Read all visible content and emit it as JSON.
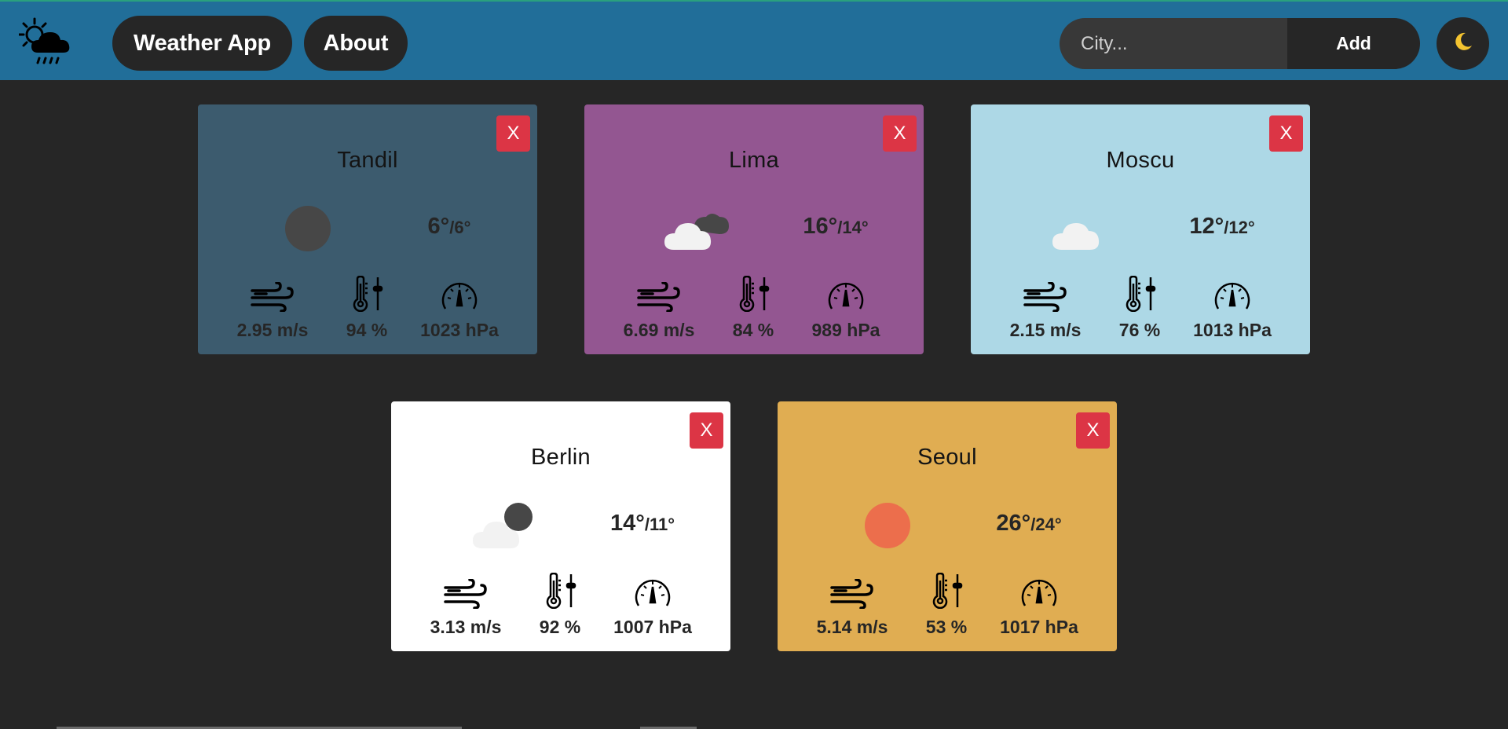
{
  "header": {
    "logo_icon": "sun-cloud-rain-icon",
    "nav": [
      {
        "label": "Weather App"
      },
      {
        "label": "About"
      }
    ],
    "search": {
      "placeholder": "City...",
      "value": "",
      "button_label": "Add"
    },
    "theme_toggle_icon": "moon-icon",
    "color": "#216e99"
  },
  "cards": [
    {
      "city": "Tandil",
      "temp_max": "6°",
      "temp_min": "/6°",
      "wind": "2.95 m/s",
      "humidity": "94 %",
      "pressure": "1023 hPa",
      "icon": "moon-icon",
      "bg": "#3c5b6e",
      "close_label": "X"
    },
    {
      "city": "Lima",
      "temp_max": "16°",
      "temp_min": "/14°",
      "wind": "6.69 m/s",
      "humidity": "84 %",
      "pressure": "989 hPa",
      "icon": "cloudy-night-icon",
      "bg": "#935691",
      "close_label": "X"
    },
    {
      "city": "Moscu",
      "temp_max": "12°",
      "temp_min": "/12°",
      "wind": "2.15 m/s",
      "humidity": "76 %",
      "pressure": "1013 hPa",
      "icon": "cloud-icon",
      "bg": "#add8e6",
      "close_label": "X"
    },
    {
      "city": "Berlin",
      "temp_max": "14°",
      "temp_min": "/11°",
      "wind": "3.13 m/s",
      "humidity": "92 %",
      "pressure": "1007 hPa",
      "icon": "partly-cloudy-night-icon",
      "bg": "#ffffff",
      "close_label": "X"
    },
    {
      "city": "Seoul",
      "temp_max": "26°",
      "temp_min": "/24°",
      "wind": "5.14 m/s",
      "humidity": "53 %",
      "pressure": "1017 hPa",
      "icon": "sun-icon",
      "bg": "#e0ad52",
      "close_label": "X"
    }
  ]
}
